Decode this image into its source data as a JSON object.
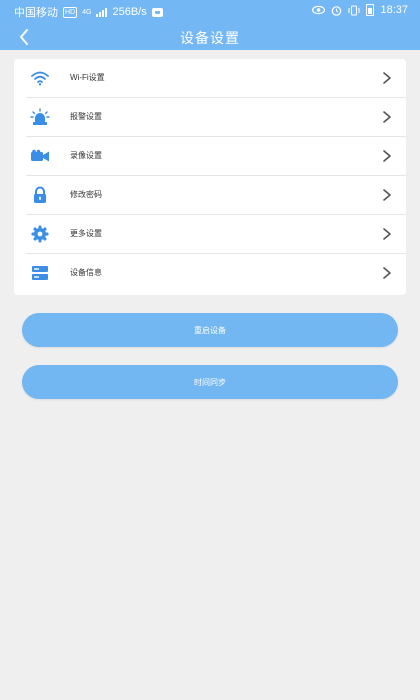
{
  "status_bar": {
    "carrier": "中国移动",
    "hd_badge": "HD",
    "network_type": "4G",
    "speed": "256B/s",
    "time": "18:37"
  },
  "header": {
    "title": "设备设置",
    "back_icon": "chevron-left-icon"
  },
  "menu": {
    "items": [
      {
        "label": "Wi-Fi设置",
        "icon": "wifi-icon"
      },
      {
        "label": "报警设置",
        "icon": "alarm-icon"
      },
      {
        "label": "录像设置",
        "icon": "video-camera-icon"
      },
      {
        "label": "修改密码",
        "icon": "lock-icon"
      },
      {
        "label": "更多设置",
        "icon": "gear-icon"
      },
      {
        "label": "设备信息",
        "icon": "device-info-icon"
      }
    ]
  },
  "actions": {
    "restart_label": "重启设备",
    "time_sync_label": "时间同步"
  },
  "colors": {
    "header_bg": "#74b7f5",
    "accent": "#3b8ee6",
    "button_bg": "#72b6f2",
    "page_bg": "#efefef"
  }
}
